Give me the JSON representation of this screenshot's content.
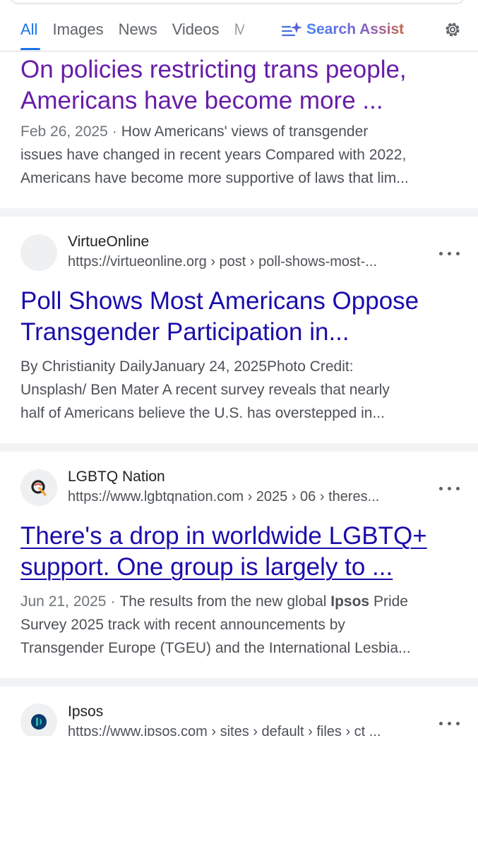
{
  "tabs": [
    {
      "label": "All",
      "active": true
    },
    {
      "label": "Images"
    },
    {
      "label": "News"
    },
    {
      "label": "Videos"
    },
    {
      "label": "M"
    }
  ],
  "search_assist": {
    "label": "Search Assist",
    "icon": "sparkle-list-icon"
  },
  "settings_icon": "gear-icon",
  "results": [
    {
      "title": "On policies restricting trans people, Americans have become more ...",
      "title_lines": [
        "On policies restricting trans people,",
        "Americans have become more ..."
      ],
      "date": "Feb 26, 2025",
      "snippet_lines": [
        "How Americans' views of transgender",
        "issues have changed in recent years Compared with 2022,",
        "Americans have become more supportive of laws that lim..."
      ]
    },
    {
      "site": "VirtueOnline",
      "url": "https://virtueonline.org › post › poll-shows-most-...",
      "title_lines": [
        "Poll Shows Most Americans Oppose",
        "Transgender Participation in..."
      ],
      "snippet_lines": [
        "By Christianity DailyJanuary 24, 2025Photo Credit:",
        "Unsplash/ Ben Mater A recent survey reveals that nearly",
        "half of Americans believe the U.S. has overstepped in..."
      ]
    },
    {
      "site": "LGBTQ Nation",
      "url": "https://www.lgbtqnation.com › 2025 › 06 › theres...",
      "title_lines": [
        "There's a drop in worldwide LGBTQ+",
        "support. One group is largely to ..."
      ],
      "date": "Jun 21, 2025",
      "snippet_line1": "The results from the new global ",
      "snippet_bold": "Ipsos",
      "snippet_line1_end": " Pride",
      "snippet_lines": [
        "Survey 2025 track with recent announcements by",
        "Transgender Europe (TGEU) and the International Lesbia..."
      ]
    },
    {
      "site": "Ipsos",
      "url": "https://www.ipsos.com › sites › default › files › ct ..."
    }
  ],
  "colors": {
    "accent": "#1a73e8",
    "visited_link": "#681da8",
    "link": "#1a0dab",
    "divider_band": "#f1f3f4"
  }
}
